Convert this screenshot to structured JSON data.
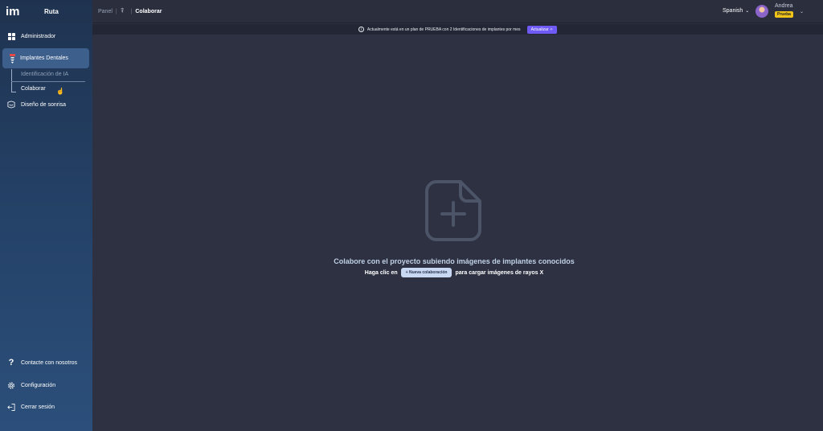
{
  "brand": {
    "logo": "im",
    "name": "Ruta"
  },
  "sidebar": {
    "admin": {
      "label": "Administrador",
      "icon": "grid-icon"
    },
    "implants": {
      "label": "Implantes Dentales",
      "icon": "implant-icon"
    },
    "sub_items": [
      {
        "label": "Identificación de IA"
      },
      {
        "label": "Colaborar"
      }
    ],
    "smile": {
      "label": "Diseño de sonrisa",
      "icon": "smile-design-icon"
    },
    "bottom": [
      {
        "label": "Contacte con nosotros",
        "icon": "question-icon"
      },
      {
        "label": "Configuración",
        "icon": "gear-icon"
      },
      {
        "label": "Cerrar sesión",
        "icon": "logout-icon"
      }
    ]
  },
  "topbar": {
    "breadcrumb": [
      "Panel",
      "Colaborar"
    ],
    "language": "Spanish",
    "user_name": "Andrea",
    "user_badge": "Prueba"
  },
  "banner": {
    "text": "Actualmente está en un plan de PRUEBA con 2 Identificaciones de implantes por mes",
    "button": "Actualizar"
  },
  "main": {
    "title": "Colabore con el proyecto subiendo imágenes de implantes conocidos",
    "line_before": "Haga clic en",
    "button": "Nueva colaboración",
    "line_after": "para cargar imágenes de rayos X"
  },
  "colors": {
    "sidebar_top": "#1f3350",
    "sidebar_active": "#3c5f8c",
    "main_bg": "#2d3142",
    "accent": "#6f5af5",
    "badge": "#f0c419"
  }
}
